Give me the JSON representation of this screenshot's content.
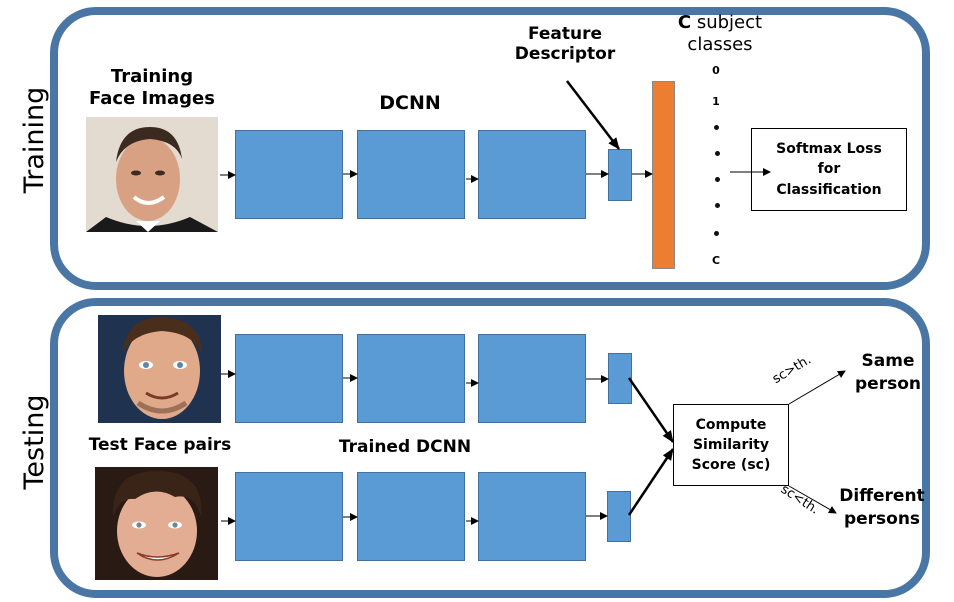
{
  "training": {
    "side_label": "Training",
    "input_label_line1": "Training",
    "input_label_line2": "Face Images",
    "network_label": "DCNN",
    "feature_label_line1": "Feature",
    "feature_label_line2": "Descriptor",
    "classes_label_bold": "C",
    "classes_label_rest": " subject",
    "classes_label_line2": "classes",
    "class_indices": [
      "0",
      "1",
      "C"
    ],
    "loss_box_lines": [
      "Softmax Loss",
      "for",
      "Classification"
    ]
  },
  "testing": {
    "side_label": "Testing",
    "input_label": "Test Face pairs",
    "network_label": "Trained DCNN",
    "similarity_box_lines": [
      "Compute",
      "Similarity",
      "Score (sc)"
    ],
    "branch_same_condition": "sc>th.",
    "branch_diff_condition": "sc<th.",
    "same_label_lines": [
      "Same",
      "person"
    ],
    "diff_label_lines": [
      "Different",
      "persons"
    ]
  },
  "colors": {
    "panel_border": "#4a76a6",
    "block_fill": "#5b9bd5",
    "classifier_fill": "#ed7d31"
  },
  "icons": {
    "face_images": [
      "face-photo-training",
      "face-photo-test-1",
      "face-photo-test-2"
    ]
  }
}
